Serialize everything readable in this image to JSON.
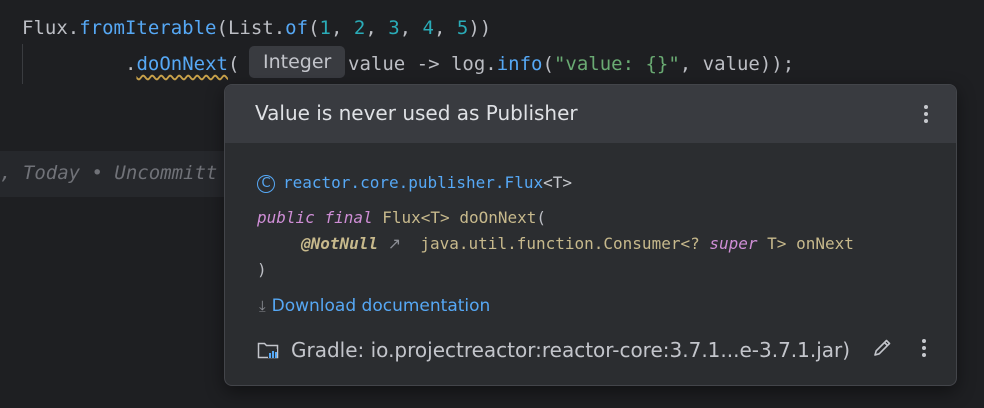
{
  "code": {
    "line1": {
      "flux": "Flux",
      "dot1": ".",
      "fromIterable": "fromIterable",
      "open1": "(",
      "list": "List",
      "dot2": ".",
      "of": "of",
      "open2": "(",
      "n1": "1",
      "c1": ", ",
      "n2": "2",
      "c2": ", ",
      "n3": "3",
      "c3": ", ",
      "n4": "4",
      "c4": ", ",
      "n5": "5",
      "close": "))"
    },
    "line2": {
      "dot": ".",
      "doOnNext": "doOnNext",
      "open": "(",
      "param": "value -> log.",
      "info": "info",
      "open2": "(",
      "str": "\"value: {}\"",
      "rest": ", value));"
    },
    "inlay_hint": "Integer",
    "blame": ", Today • Uncommitt"
  },
  "popup": {
    "title": "Value is never used as Publisher",
    "class_icon": "class-icon",
    "class_name": "reactor.core.publisher.Flux",
    "class_type_param": "<T>",
    "sig": {
      "kw_public": "public",
      "kw_final": "final",
      "ret_type": "Flux<T>",
      "method": "doOnNext",
      "open": "(",
      "anno": "@NotNull",
      "arrow": "↗",
      "param_type1": "java.util.function.Consumer<? ",
      "kw_super": "super",
      "param_type2": " T>",
      "param_name": "onNext",
      "close": ")"
    },
    "download_label": "Download documentation",
    "footer_text": "Gradle: io.projectreactor:reactor-core:3.7.1...e-3.7.1.jar)"
  },
  "colors": {
    "background": "#1e1f22",
    "popup_bg": "#2b2d30",
    "link": "#56a8f5",
    "keyword": "#cf8ed6",
    "number": "#2aacb8",
    "string": "#6aab73"
  }
}
